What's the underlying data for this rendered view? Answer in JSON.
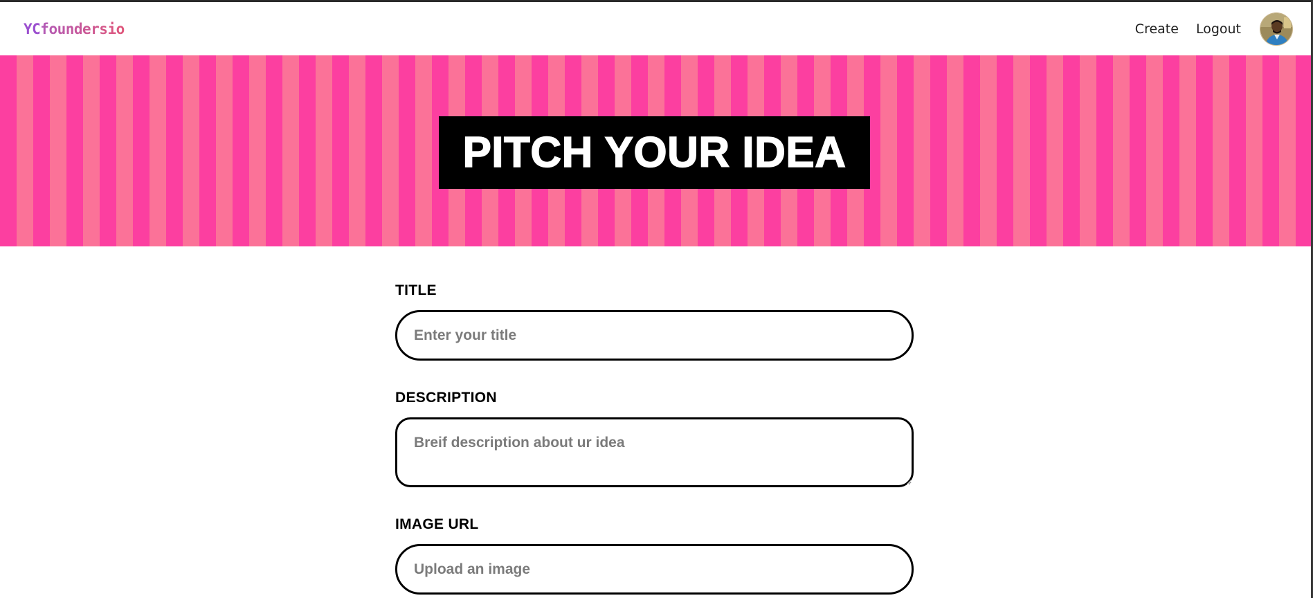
{
  "navbar": {
    "logo_prefix": "YC",
    "logo_rest": "foundersio",
    "links": {
      "create": "Create",
      "logout": "Logout"
    },
    "avatar_icon": "user-avatar"
  },
  "hero": {
    "title": "PITCH YOUR IDEA",
    "stripe_colors": [
      "#fc3fa0",
      "#fb7298"
    ],
    "title_box_color": "#000000"
  },
  "form": {
    "title": {
      "label": "TITLE",
      "placeholder": "Enter your title",
      "value": ""
    },
    "description": {
      "label": "DESCRIPTION",
      "placeholder": "Breif description about ur idea",
      "value": ""
    },
    "image_url": {
      "label": "IMAGE URL",
      "placeholder": "Upload an image",
      "value": ""
    }
  },
  "colors": {
    "accent_pink": "#fc3fa0",
    "accent_purple": "#9b4fcf",
    "text": "#000000",
    "placeholder": "#7b7b7b"
  }
}
